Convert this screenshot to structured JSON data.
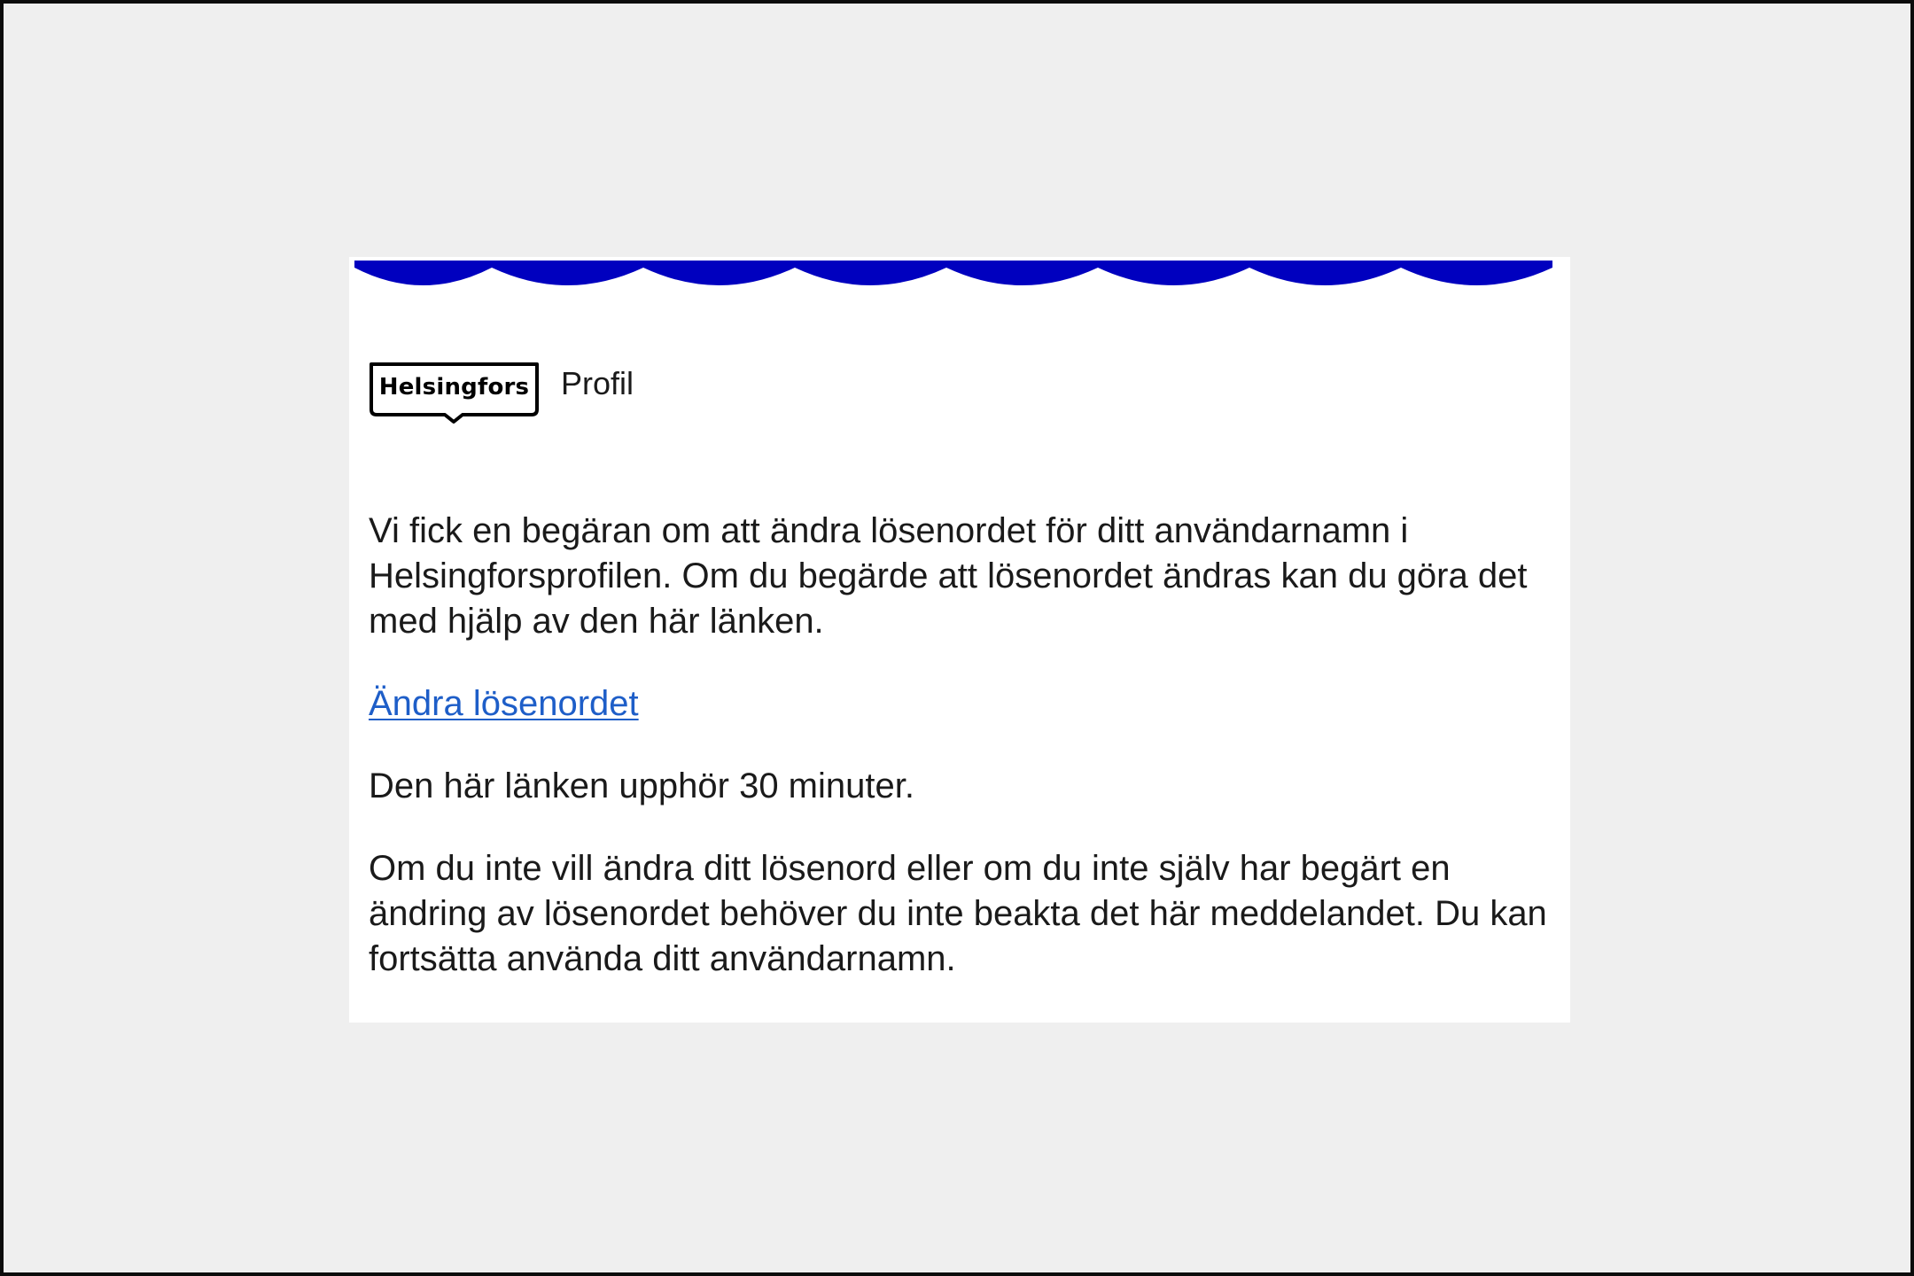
{
  "header": {
    "logo_text": "Helsingfors",
    "title": "Profil"
  },
  "body": {
    "paragraph_1": "Vi fick en begäran om att ändra lösenordet för ditt användarnamn i Helsingforsprofilen. Om du begärde att lösenordet ändras kan du göra det med hjälp av den här länken.",
    "link_label": "Ändra lösenordet",
    "paragraph_2": "Den här länken upphör 30 minuter.",
    "paragraph_3": "Om du inte vill ändra ditt lösenord eller om du inte själv har begärt en ändring av lösenordet behöver du inte beakta det här meddelandet. Du kan fortsätta använda ditt användarnamn."
  },
  "colors": {
    "page_background": "#efefef",
    "card_background": "#ffffff",
    "wave_blue": "#0000bf",
    "link": "#1e5ec8",
    "text": "#1a1a1a"
  }
}
